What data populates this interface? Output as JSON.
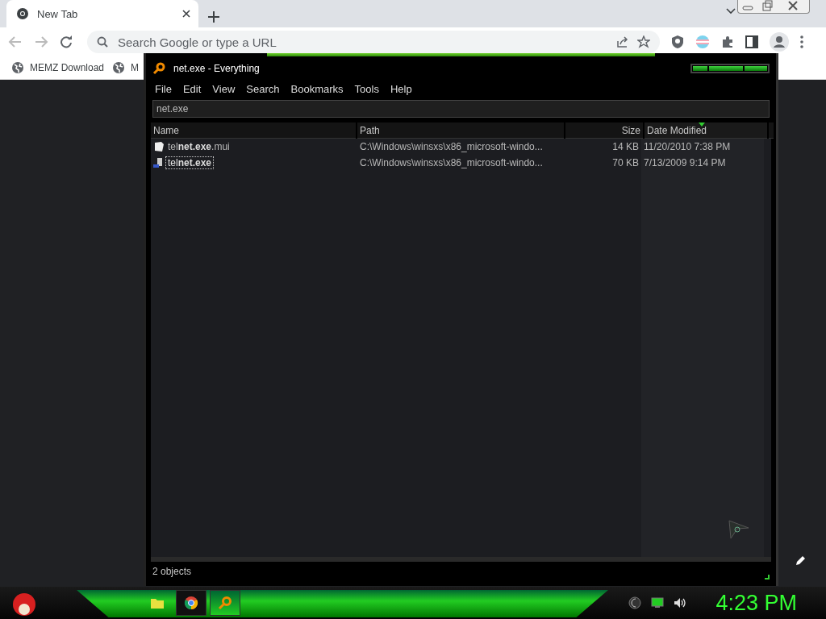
{
  "browser": {
    "tabs": [
      {
        "title": "New Tab",
        "selected": true
      }
    ],
    "address": {
      "placeholder": "Search Google or type a URL"
    },
    "bookmarks": [
      "MEMZ Download",
      "M"
    ]
  },
  "window": {
    "title": "net.exe - Everything",
    "menu": [
      "File",
      "Edit",
      "View",
      "Search",
      "Bookmarks",
      "Tools",
      "Help"
    ],
    "search": {
      "value": "net.exe"
    },
    "columns": [
      {
        "label": "Name",
        "sorted": false
      },
      {
        "label": "Path",
        "sorted": false
      },
      {
        "label": "Size",
        "sorted": false
      },
      {
        "label": "Date Modified",
        "sorted": true
      }
    ],
    "rows": [
      {
        "kind": "document",
        "name": "tel**net.exe**.mui",
        "path": "C:\\Windows\\winsxs\\x86_microsoft-windo...",
        "size": "14 KB",
        "date": "11/20/2010 7:38 PM",
        "selected": false
      },
      {
        "kind": "program",
        "name": "tel**net.exe**",
        "path": "C:\\Windows\\winsxs\\x86_microsoft-windo...",
        "size": "70 KB",
        "date": "7/13/2009 9:14 PM",
        "selected": true
      }
    ],
    "status": "2 objects"
  },
  "taskbar": {
    "items": [
      {
        "kind": "folder",
        "selected": false
      },
      {
        "kind": "browser",
        "selected": false
      },
      {
        "kind": "search",
        "selected": true
      }
    ],
    "clock": "4:23 PM"
  }
}
